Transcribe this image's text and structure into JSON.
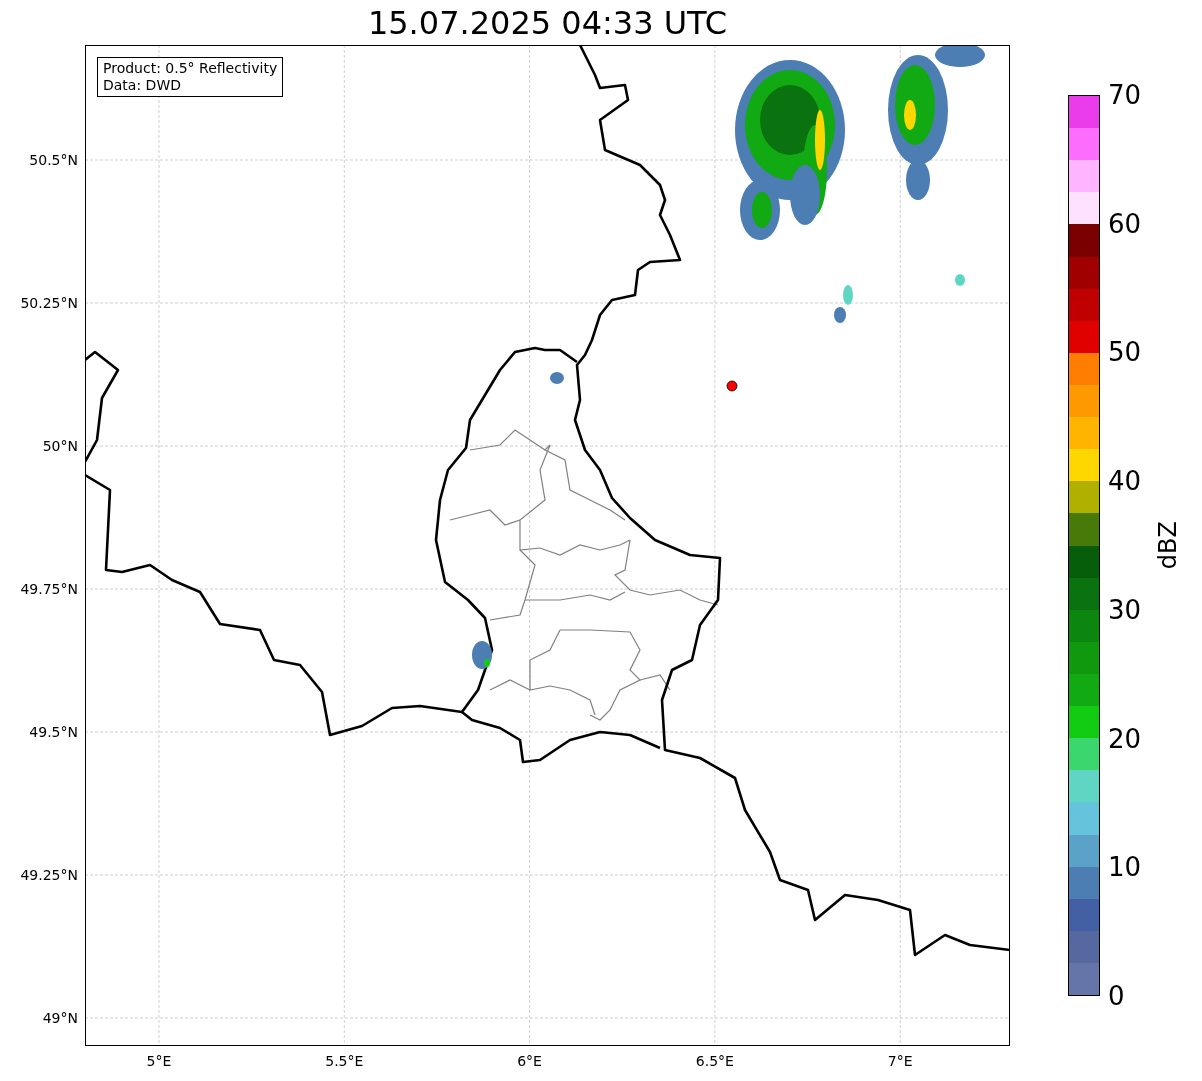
{
  "title": "15.07.2025 04:33 UTC",
  "info_box": [
    "Product: 0.5° Reflectivity",
    "Data: DWD"
  ],
  "y_ticks": [
    "50.5°N",
    "50.25°N",
    "50°N",
    "49.75°N",
    "49.5°N",
    "49.25°N",
    "49°N"
  ],
  "x_ticks": [
    "5°E",
    "5.5°E",
    "6°E",
    "6.5°E",
    "7°E"
  ],
  "colorbar": {
    "label": "dBZ",
    "ticks": [
      "70",
      "60",
      "50",
      "40",
      "30",
      "20",
      "10",
      "0"
    ],
    "bins": [
      {
        "color": "#eb3ceb"
      },
      {
        "color": "#fd6dfd"
      },
      {
        "color": "#feb4fe"
      },
      {
        "color": "#fee1fe"
      },
      {
        "color": "#7a0000"
      },
      {
        "color": "#a00000"
      },
      {
        "color": "#c00000"
      },
      {
        "color": "#e00000"
      },
      {
        "color": "#ff7d00"
      },
      {
        "color": "#ff9900"
      },
      {
        "color": "#ffb400"
      },
      {
        "color": "#ffd700"
      },
      {
        "color": "#b0b000"
      },
      {
        "color": "#487a0a"
      },
      {
        "color": "#065e0a"
      },
      {
        "color": "#0a720f"
      },
      {
        "color": "#0d860f"
      },
      {
        "color": "#10980f"
      },
      {
        "color": "#12aa12"
      },
      {
        "color": "#12cc14"
      },
      {
        "color": "#3cd66e"
      },
      {
        "color": "#5fd6c3"
      },
      {
        "color": "#66c3dc"
      },
      {
        "color": "#5ba2c8"
      },
      {
        "color": "#4c7db3"
      },
      {
        "color": "#4460a4"
      },
      {
        "color": "#5568a0"
      },
      {
        "color": "#6575aa"
      }
    ]
  }
}
